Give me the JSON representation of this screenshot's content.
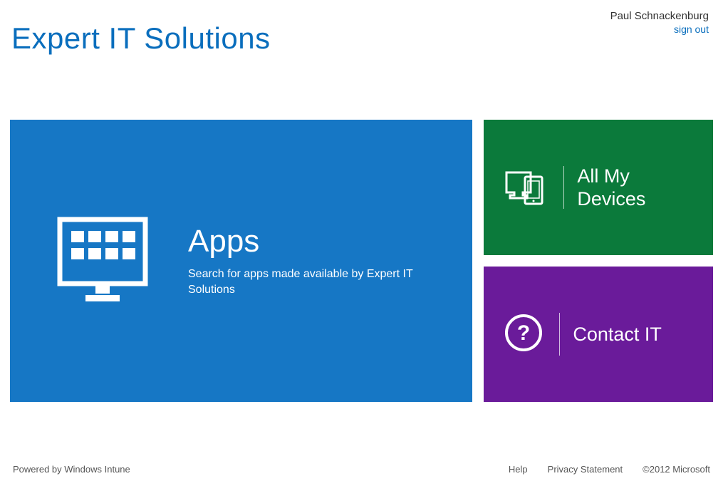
{
  "header": {
    "title": "Expert IT Solutions",
    "username": "Paul Schnackenburg",
    "signout": "sign out"
  },
  "tiles": {
    "apps": {
      "title": "Apps",
      "description": "Search for apps made available by Expert IT Solutions"
    },
    "devices": {
      "line1": "All My",
      "line2": "Devices"
    },
    "contact": {
      "title": "Contact IT"
    }
  },
  "footer": {
    "powered": "Powered by Windows Intune",
    "help": "Help",
    "privacy": "Privacy Statement",
    "copyright": "©2012 Microsoft"
  },
  "colors": {
    "brand": "#0a6ebd",
    "apps_tile": "#1677c5",
    "devices_tile": "#0b7a3b",
    "contact_tile": "#6a1b9a"
  }
}
